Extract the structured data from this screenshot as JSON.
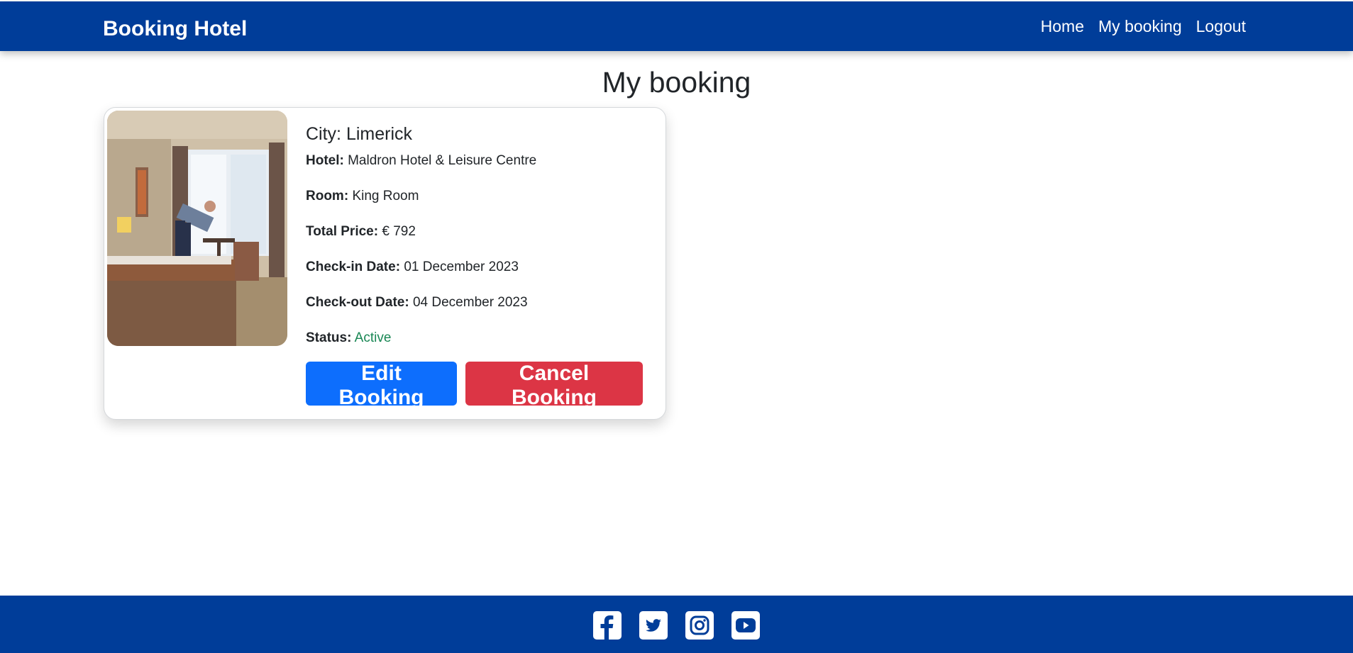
{
  "nav": {
    "brand": "Booking Hotel",
    "links": [
      {
        "label": "Home"
      },
      {
        "label": "My booking"
      },
      {
        "label": "Logout"
      }
    ]
  },
  "page": {
    "title": "My booking"
  },
  "booking": {
    "city": "City: Limerick",
    "hotel_label": "Hotel:",
    "hotel": "Maldron Hotel & Leisure Centre",
    "room_label": "Room:",
    "room": "King Room",
    "price_label": "Total Price:",
    "price": "€ 792",
    "checkin_label": "Check-in Date:",
    "checkin": "01 December 2023",
    "checkout_label": "Check-out Date:",
    "checkout": "04 December 2023",
    "status_label": "Status:",
    "status": "Active",
    "edit_label": "Edit Booking",
    "cancel_label": "Cancel Booking"
  },
  "footer": {
    "icons": [
      "facebook-icon",
      "twitter-icon",
      "instagram-icon",
      "youtube-icon"
    ]
  },
  "colors": {
    "navbar": "#003d99",
    "edit_button": "#0d6efd",
    "cancel_button": "#dc3545",
    "status_active": "#198754"
  }
}
